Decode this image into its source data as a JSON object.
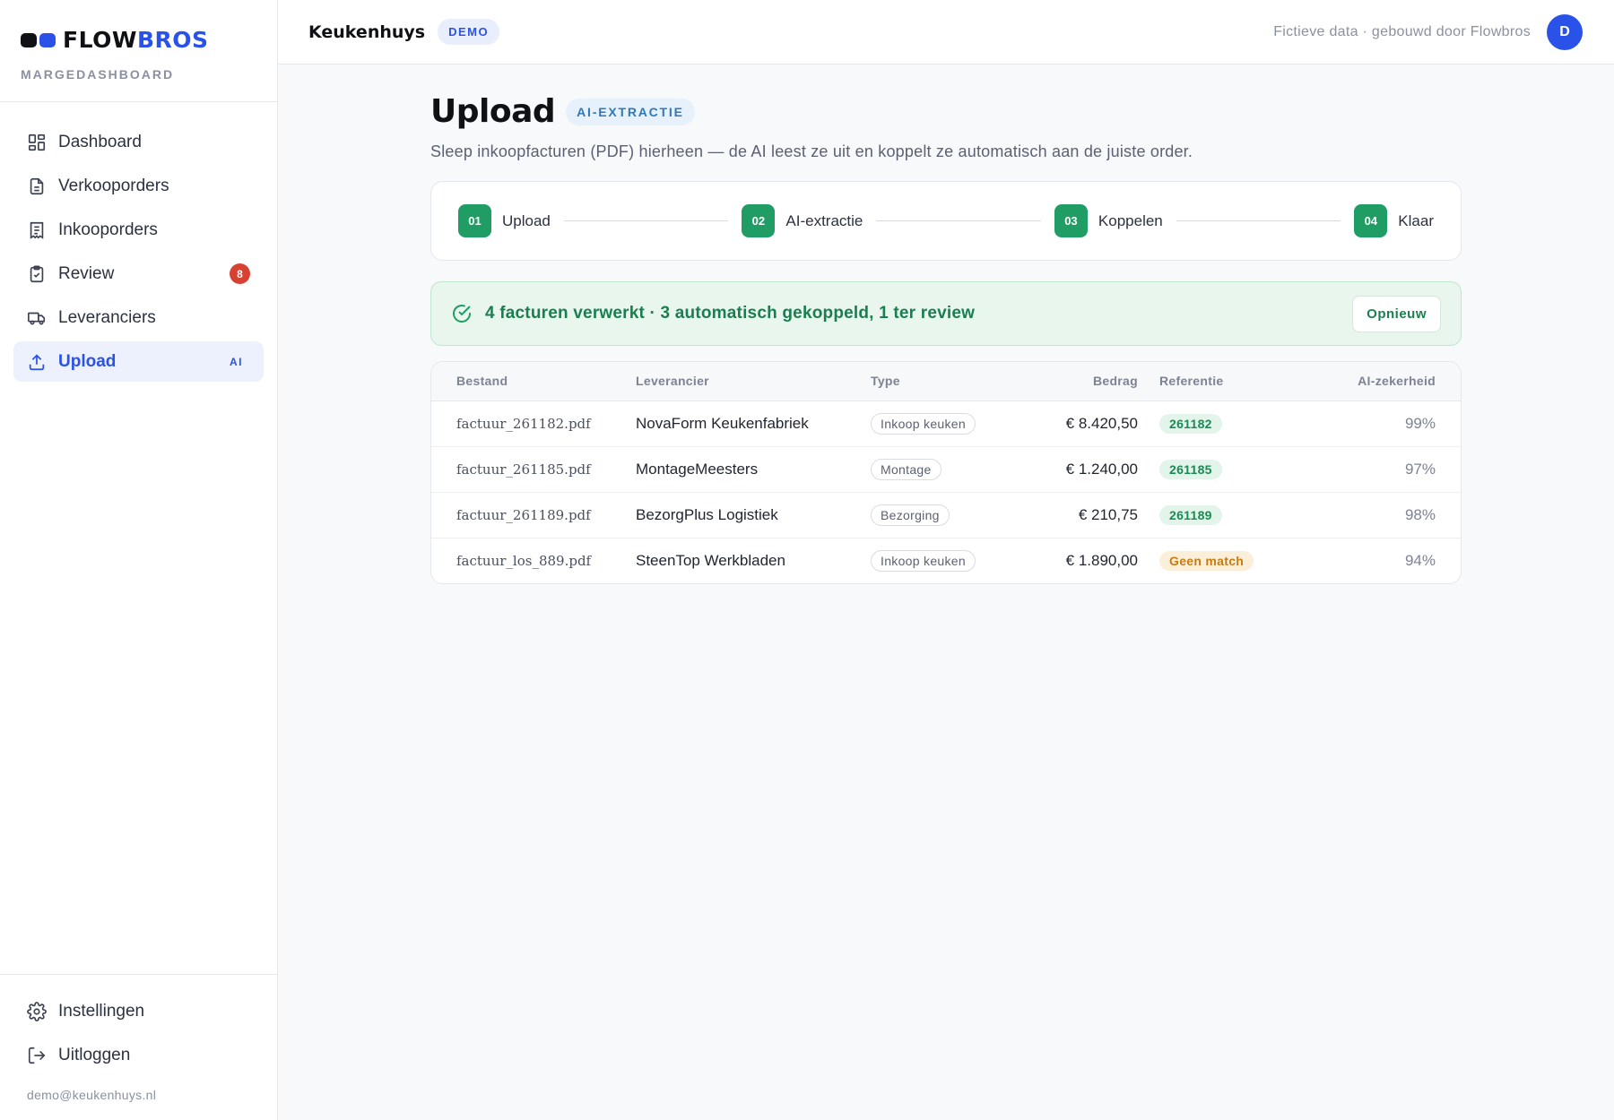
{
  "brand": {
    "logo_text_main": "FLOW",
    "logo_text_accent": "BROS",
    "subtitle": "MARGEDASHBOARD",
    "colors": {
      "dark": "#0f1115",
      "accent": "#2a52e8"
    }
  },
  "sidebar": {
    "items": [
      {
        "label": "Dashboard",
        "icon": "grid-icon"
      },
      {
        "label": "Verkooporders",
        "icon": "document-icon"
      },
      {
        "label": "Inkooporders",
        "icon": "receipt-icon"
      },
      {
        "label": "Review",
        "icon": "clipboard-check-icon",
        "badge": "8"
      },
      {
        "label": "Leveranciers",
        "icon": "truck-icon"
      },
      {
        "label": "Upload",
        "icon": "upload-icon",
        "badge": "AI",
        "active": true
      }
    ],
    "footer": {
      "settings_label": "Instellingen",
      "logout_label": "Uitloggen",
      "user_email": "demo@keukenhuys.nl"
    }
  },
  "topbar": {
    "tenant": "Keukenhuys",
    "demo_badge": "DEMO",
    "note": "Fictieve data · gebouwd door Flowbros",
    "avatar_initial": "D"
  },
  "page": {
    "title": "Upload",
    "badge": "AI-EXTRACTIE",
    "subtitle": "Sleep inkoopfacturen (PDF) hierheen — de AI leest ze uit en koppelt ze automatisch aan de juiste order."
  },
  "steps": [
    {
      "num": "01",
      "label": "Upload"
    },
    {
      "num": "02",
      "label": "AI-extractie"
    },
    {
      "num": "03",
      "label": "Koppelen"
    },
    {
      "num": "04",
      "label": "Klaar"
    }
  ],
  "result": {
    "message": "4 facturen verwerkt · 3 automatisch gekoppeld, 1 ter review",
    "retry_label": "Opnieuw",
    "status_color": "#1a7f4f"
  },
  "table": {
    "headers": [
      "Bestand",
      "Leverancier",
      "Type",
      "Bedrag",
      "Referentie",
      "AI-zekerheid"
    ],
    "rows": [
      {
        "file": "factuur_261182.pdf",
        "supplier": "NovaForm Keukenfabriek",
        "type": "Inkoop keuken",
        "amount": "€ 8.420,50",
        "reference": "261182",
        "ref_status": "matched",
        "confidence": "99%"
      },
      {
        "file": "factuur_261185.pdf",
        "supplier": "MontageMeesters",
        "type": "Montage",
        "amount": "€ 1.240,00",
        "reference": "261185",
        "ref_status": "matched",
        "confidence": "97%"
      },
      {
        "file": "factuur_261189.pdf",
        "supplier": "BezorgPlus Logistiek",
        "type": "Bezorging",
        "amount": "€ 210,75",
        "reference": "261189",
        "ref_status": "matched",
        "confidence": "98%"
      },
      {
        "file": "factuur_los_889.pdf",
        "supplier": "SteenTop Werkbladen",
        "type": "Inkoop keuken",
        "amount": "€ 1.890,00",
        "reference": "Geen match",
        "ref_status": "warning",
        "confidence": "94%"
      }
    ]
  }
}
